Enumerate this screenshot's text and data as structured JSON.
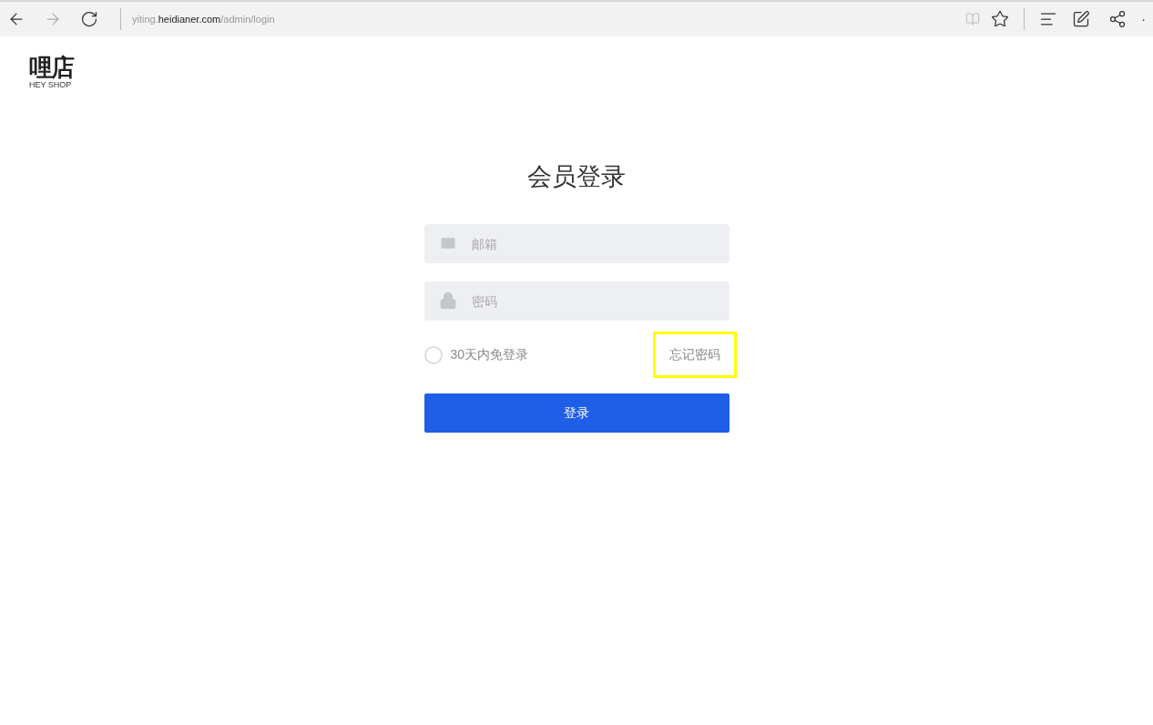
{
  "browser": {
    "url": {
      "subdomain": "yiting.",
      "domain": "heidianer.com",
      "path": "/admin/login"
    },
    "more": "·"
  },
  "logo": {
    "mark": "哩店",
    "subtitle": "HEY SHOP"
  },
  "login": {
    "title": "会员登录",
    "fields": [
      {
        "kind": "email",
        "placeholder": "邮箱"
      },
      {
        "kind": "password",
        "placeholder": "密码"
      }
    ],
    "remember": {
      "label": "30天内免登录",
      "checked": false
    },
    "forgot": {
      "label": "忘记密码",
      "highlighted": true
    },
    "submit": "登录"
  }
}
